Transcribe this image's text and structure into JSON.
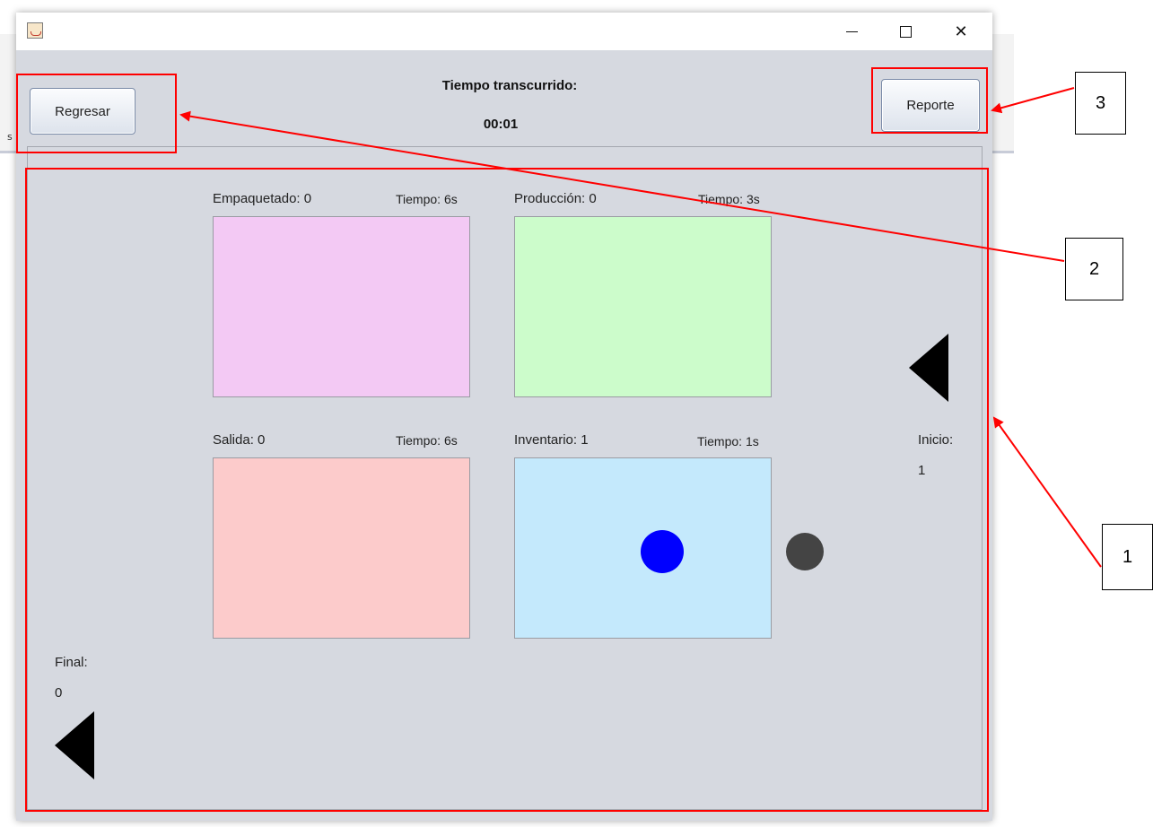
{
  "header": {
    "timer_label": "Tiempo transcurrido:",
    "timer_value": "00:01",
    "back_button": "Regresar",
    "report_button": "Reporte"
  },
  "stations": [
    {
      "label": "Empaquetado: 0",
      "time": "Tiempo: 6s",
      "color": "#f3c9f4"
    },
    {
      "label": "Producción: 0",
      "time": "Tiempo: 3s",
      "color": "#ccfccb"
    },
    {
      "label": "Salida: 0",
      "time": "Tiempo: 6s",
      "color": "#fccbcb"
    },
    {
      "label": "Inventario: 1",
      "time": "Tiempo: 1s",
      "color": "#c4e9fc"
    }
  ],
  "start": {
    "label": "Inicio:",
    "count": "1"
  },
  "end": {
    "label": "Final:",
    "count": "0"
  },
  "annotations": [
    "1",
    "2",
    "3"
  ],
  "background_fragment": "s",
  "colors": {
    "annotation": "#ff0000",
    "item_blue": "#0000ff",
    "item_gray": "#444444"
  }
}
